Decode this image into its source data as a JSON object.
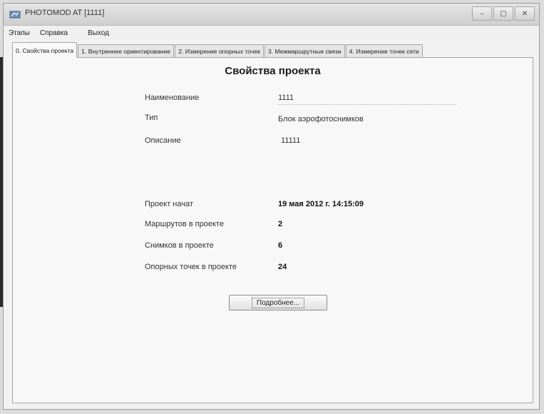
{
  "window": {
    "title": "PHOTOMOD AT [1111]",
    "controls": [
      "–",
      "▢",
      "✕"
    ]
  },
  "menu": {
    "items": [
      "Этапы",
      "Справка",
      "Выход"
    ]
  },
  "tabs": [
    {
      "label": "0. Свойства проекта",
      "active": true
    },
    {
      "label": "1. Внутреннее ориентирование",
      "active": false
    },
    {
      "label": "2. Измерение опорных точек",
      "active": false
    },
    {
      "label": "3. Межмаршрутные связи",
      "active": false
    },
    {
      "label": "4. Измерение точек сети",
      "active": false
    }
  ],
  "panel": {
    "title": "Свойства проекта",
    "fields": {
      "name_label": "Наименование",
      "name_value": "1111",
      "type_label": "Тип",
      "type_value": "Блок аэрофотоснимков",
      "description_label": "Описание",
      "description_value": "11111"
    },
    "stats": {
      "started_label": "Проект начат",
      "started_value": "19 мая 2012 г. 14:15:09",
      "routes_label": "Маршрутов в проекте",
      "routes_value": "2",
      "images_label": "Снимков в проекте",
      "images_value": "6",
      "control_points_label": "Опорных точек в проекте",
      "control_points_value": "24"
    },
    "details_button": "Подробнее..."
  }
}
